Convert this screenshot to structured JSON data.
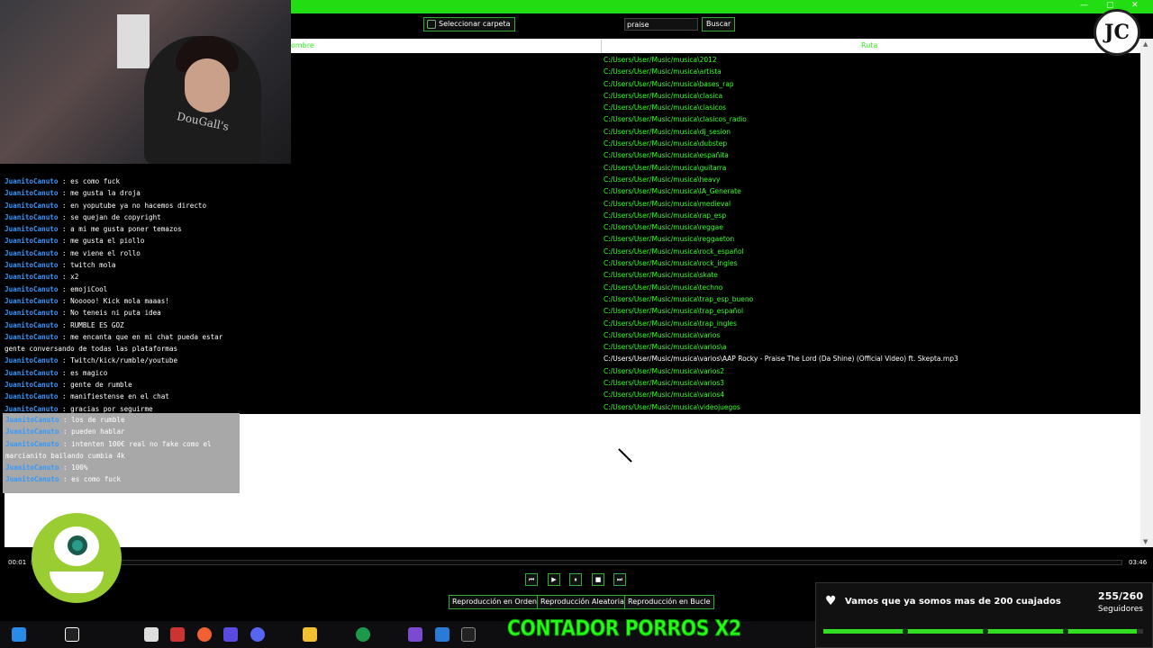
{
  "toolbar": {
    "folder_button": "Seleccionar carpeta",
    "search_value": "praise",
    "search_button": "Buscar"
  },
  "table": {
    "col_name": "Nombre",
    "col_path": "Ruta",
    "rows": [
      "C:/Users/User/Music/musica\\2012",
      "C:/Users/User/Music/musica\\artista",
      "C:/Users/User/Music/musica\\bases_rap",
      "C:/Users/User/Music/musica\\clasica",
      "C:/Users/User/Music/musica\\clasicos",
      "C:/Users/User/Music/musica\\clasicos_radio",
      "C:/Users/User/Music/musica\\dj_sesion",
      "C:/Users/User/Music/musica\\dubstep",
      "C:/Users/User/Music/musica\\españita",
      "C:/Users/User/Music/musica\\guitarra",
      "C:/Users/User/Music/musica\\heavy",
      "C:/Users/User/Music/musica\\IA_Generate",
      "C:/Users/User/Music/musica\\medieval",
      "C:/Users/User/Music/musica\\rap_esp",
      "C:/Users/User/Music/musica\\reggae",
      "C:/Users/User/Music/musica\\reggaeton",
      "C:/Users/User/Music/musica\\rock_español",
      "C:/Users/User/Music/musica\\rock_ingles",
      "C:/Users/User/Music/musica\\skate",
      "C:/Users/User/Music/musica\\techno",
      "C:/Users/User/Music/musica\\trap_esp_bueno",
      "C:/Users/User/Music/musica\\trap_español",
      "C:/Users/User/Music/musica\\trap_ingles",
      "C:/Users/User/Music/musica\\varios",
      "C:/Users/User/Music/musica\\varios\\a",
      "C:/Users/User/Music/musica\\varios\\AAP Rocky - Praise The Lord (Da Shine) (Official Video) ft. Skepta.mp3",
      "C:/Users/User/Music/musica\\varios2",
      "C:/Users/User/Music/musica\\varios3",
      "C:/Users/User/Music/musica\\varios4",
      "C:/Users/User/Music/musica\\videojuegos"
    ]
  },
  "player": {
    "current_time": "00:01",
    "total_time": "03:46",
    "mode_order": "Reproducción en Orden",
    "mode_random": "Reproducción Aleatoria",
    "mode_loop": "Reproducción en Bucle"
  },
  "chat": {
    "messages": [
      {
        "user": "JuanitoCanuto",
        "text": ": es como fuck"
      },
      {
        "user": "JuanitoCanuto",
        "text": ": me gusta la droja"
      },
      {
        "user": "JuanitoCanuto",
        "text": ": en yoputube ya no hacemos directo"
      },
      {
        "user": "JuanitoCanuto",
        "text": ": se quejan de copyright"
      },
      {
        "user": "JuanitoCanuto",
        "text": ": a mi me gusta poner temazos"
      },
      {
        "user": "JuanitoCanuto",
        "text": ": me gusta el piollo"
      },
      {
        "user": "JuanitoCanuto",
        "text": ": me viene el rollo"
      },
      {
        "user": "JuanitoCanuto",
        "text": ": twitch mola"
      },
      {
        "user": "JuanitoCanuto",
        "text": ": x2"
      },
      {
        "user": "JuanitoCanuto",
        "text": ": emojiCool"
      },
      {
        "user": "JuanitoCanuto",
        "text": ": Nooooo! Kick mola maaas!"
      },
      {
        "user": "JuanitoCanuto",
        "text": ": No teneis ni puta idea"
      },
      {
        "user": "JuanitoCanuto",
        "text": ": RUMBLE ES GOZ"
      },
      {
        "user": "JuanitoCanuto",
        "text": ": me encanta que en mi chat pueda estar gente conversando de todas las plataformas"
      },
      {
        "user": "JuanitoCanuto",
        "text": ": Twitch/kick/rumble/youtube"
      },
      {
        "user": "JuanitoCanuto",
        "text": ": es magico"
      },
      {
        "user": "JuanitoCanuto",
        "text": ": gente de rumble"
      },
      {
        "user": "JuanitoCanuto",
        "text": ": manifiestense en el chat"
      },
      {
        "user": "JuanitoCanuto",
        "text": ": gracias por seguirme"
      }
    ],
    "box_messages": [
      {
        "user": "JuanitoCanuto",
        "text": ": los de rumble"
      },
      {
        "user": "JuanitoCanuto",
        "text": ": pueden hablar"
      },
      {
        "user": "JuanitoCanuto",
        "text": ": intenten 100€ real no fake como el marcianito bailando cumbia 4k"
      },
      {
        "user": "JuanitoCanuto",
        "text": ": 100%"
      },
      {
        "user": "JuanitoCanuto",
        "text": ": es como fuck"
      }
    ]
  },
  "webcam": {
    "shirt_text": "DouGall's"
  },
  "notification": {
    "message": "Vamos que ya somos mas de 200 cuajados",
    "count": "255/260",
    "label": "Seguidores",
    "progress": 0.98
  },
  "overlay": {
    "counter": "CONTADOR PORROS X2",
    "logo": "JC"
  },
  "colors": {
    "accent_green": "#22dd11",
    "path_green": "#33ff22",
    "username_blue": "#3399ff"
  }
}
